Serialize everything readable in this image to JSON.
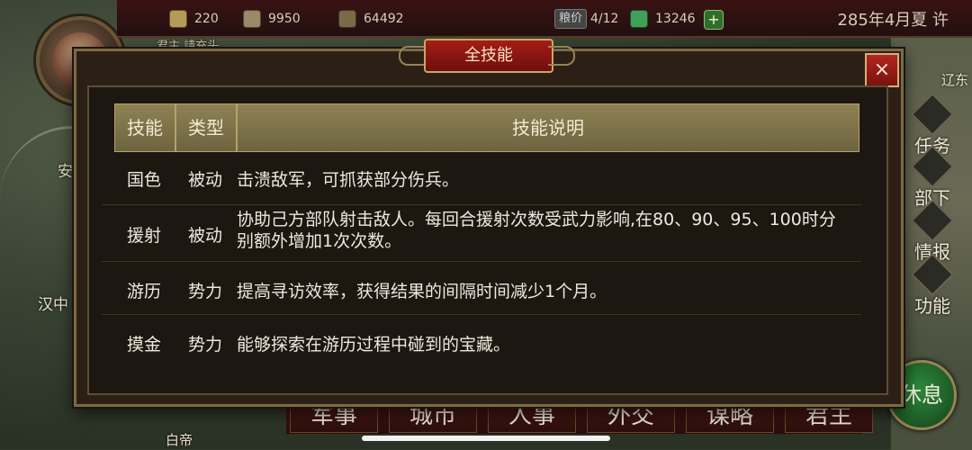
{
  "topbar": {
    "resources": [
      {
        "icon": "gold-icon",
        "value": "220",
        "color": "#b89a58"
      },
      {
        "icon": "food-bag-icon",
        "value": "9950",
        "color": "#9a8a6a"
      },
      {
        "icon": "wood-icon",
        "value": "64492",
        "color": "#7a6a48"
      },
      {
        "icon": "jade-icon",
        "value": "13246",
        "color": "#3fa05a"
      }
    ],
    "grain_price_label": "粮价",
    "grain_price_value": "4/12",
    "date": "285年4月夏 许"
  },
  "map": {
    "city_labels": [
      "安",
      "汉中",
      "白帝",
      "辽东"
    ],
    "lord_partial": "君主 請充头"
  },
  "side_menu": [
    {
      "label": "任务",
      "icon": "task-icon"
    },
    {
      "label": "部下",
      "icon": "subordinate-icon"
    },
    {
      "label": "情报",
      "icon": "intel-icon"
    },
    {
      "label": "功能",
      "icon": "gear-icon"
    }
  ],
  "bottom_menu": [
    "军事",
    "城市",
    "人事",
    "外交",
    "谋略",
    "君主"
  ],
  "rest_button": "休息",
  "dialog": {
    "title": "全技能",
    "close_label": "×",
    "headers": {
      "name": "技能",
      "type": "类型",
      "desc": "技能说明"
    },
    "rows": [
      {
        "name": "国色",
        "type": "被动",
        "desc": "击溃敌军，可抓获部分伤兵。"
      },
      {
        "name": "援射",
        "type": "被动",
        "desc": "协助己方部队射击敌人。每回合援射次数受武力影响,在80、90、95、100时分别额外增加1次次数。"
      },
      {
        "name": "游历",
        "type": "势力",
        "desc": "提高寻访效率，获得结果的间隔时间减少1个月。"
      },
      {
        "name": "摸金",
        "type": "势力",
        "desc": "能够探索在游历过程中碰到的宝藏。"
      }
    ]
  }
}
